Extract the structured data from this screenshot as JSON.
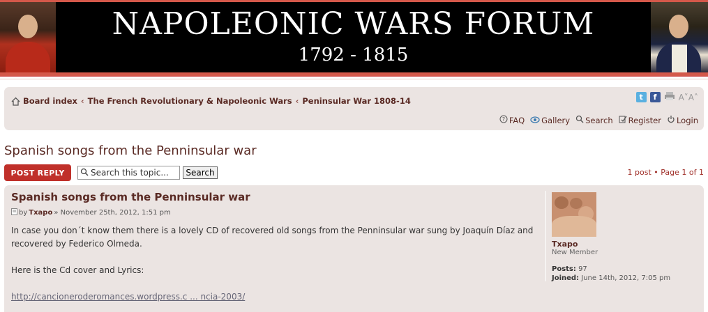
{
  "banner": {
    "title": "NAPOLEONIC WARS FORUM",
    "years": "1792 - 1815"
  },
  "breadcrumb": {
    "items": [
      {
        "label": "Board index"
      },
      {
        "label": "The French Revolutionary & Napoleonic Wars"
      },
      {
        "label": "Peninsular War 1808-14"
      }
    ],
    "separator": "‹"
  },
  "tools": {
    "twitter": "t",
    "facebook": "f",
    "font_size": "A˅A˄"
  },
  "navlinks": {
    "faq": "FAQ",
    "gallery": "Gallery",
    "search": "Search",
    "register": "Register",
    "login": "Login"
  },
  "topic": {
    "title": "Spanish songs from the Penninsular war",
    "post_reply": "POST REPLY",
    "search_placeholder": "Search this topic...",
    "search_value": "Search this topic...",
    "search_button": "Search",
    "pagination": "1 post • Page 1 of 1"
  },
  "post": {
    "subject": "Spanish songs from the Penninsular war",
    "by": "by",
    "author": "Txapo",
    "date": " » November 25th, 2012, 1:51 pm",
    "body": [
      "In case you don´t know them there is a lovely CD of recovered old songs from the Penninsular war sung by Joaquín Díaz and recovered by Federico Olmeda.",
      "Here is the Cd cover and Lyrics:"
    ],
    "link": "http://cancioneroderomances.wordpress.c ... ncia-2003/"
  },
  "profile": {
    "name": "Txapo",
    "rank": "New Member",
    "posts_label": "Posts:",
    "posts_value": " 97",
    "joined_label": "Joined:",
    "joined_value": " June 14th, 2012, 7:05 pm"
  }
}
